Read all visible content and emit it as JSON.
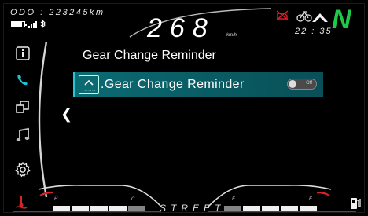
{
  "header": {
    "odometer": "ODO : 223245km",
    "speed": "268",
    "speed_unit": "km/h",
    "gear": "N",
    "clock": "22 : 35"
  },
  "sidebar": {
    "items": [
      {
        "icon": "info-icon"
      },
      {
        "icon": "phone-icon",
        "active": true
      },
      {
        "icon": "windows-icon"
      },
      {
        "icon": "music-icon"
      },
      {
        "icon": "settings-gear-icon"
      }
    ]
  },
  "main": {
    "title": "Gear Change Reminder",
    "setting": {
      "label": ".Gear  Change Reminder",
      "toggle_text": "Off"
    }
  },
  "bottom": {
    "mode": "STREET",
    "left_gauge_marks": [
      "H",
      "C"
    ],
    "right_gauge_marks": [
      "F",
      "E"
    ]
  },
  "colors": {
    "accent": "#24c6d3",
    "gear": "#1ec94a",
    "warning": "#d8232a",
    "row_bg": "#0b6b73"
  }
}
